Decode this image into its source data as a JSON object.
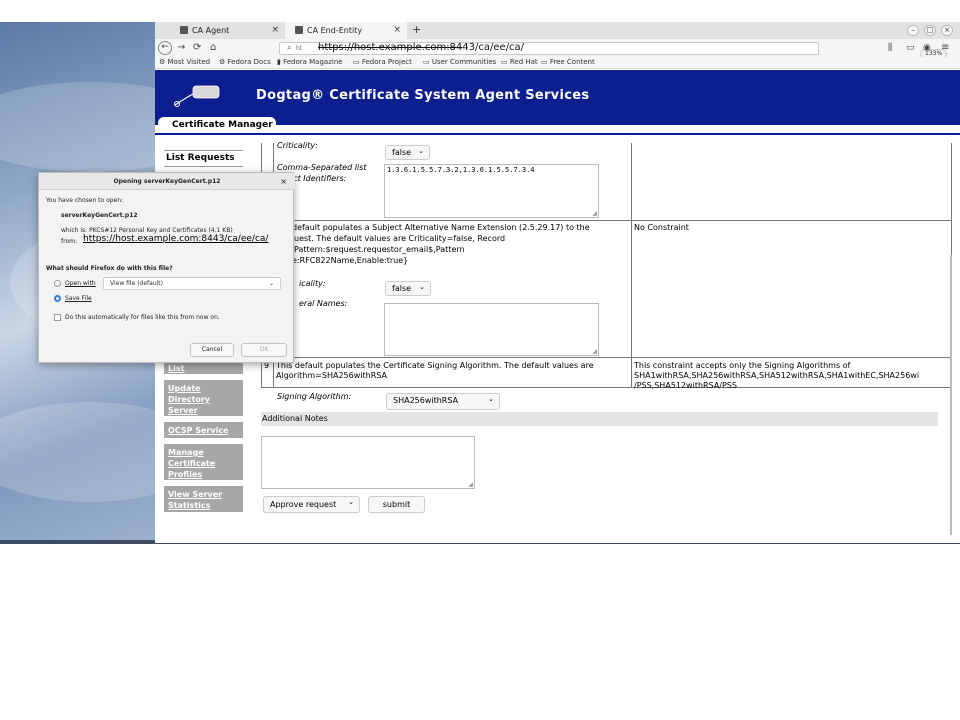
{
  "browser": {
    "tabs": [
      {
        "label": "CA Agent"
      },
      {
        "label": "CA End-Entity"
      }
    ],
    "new_tab": "+",
    "window_buttons": [
      "–",
      "□",
      "×"
    ],
    "url": {
      "struck": "https://host.example.com:84",
      "rest": "43/ca/ee/ca/",
      "prefix": "ht"
    },
    "zoom": "133%",
    "bookmarks": [
      "Most Visited",
      "Fedora Docs",
      "Fedora Magazine",
      "Fedora Project",
      "User Communities",
      "Red Hat",
      "Free Content"
    ]
  },
  "page": {
    "header_title": "Dogtag® Certificate System Agent Services",
    "logo_text": "Dogtag",
    "tab_label": "Certificate Manager",
    "sidebar": {
      "list_requests": "List Requests",
      "list_tail": "List",
      "update_directory": "Update Directory Server",
      "ocsp": "OCSP Service",
      "manage_profiles": "Manage Certificate Profiles",
      "view_stats": "View Server Statistics"
    },
    "row_top": {
      "criticality_label": "Criticality:",
      "criticality_value": "false",
      "oid_label_1": "Comma-Separated list",
      "oid_label_2": "bject Identifiers:",
      "oid_value": "1.3.6.1.5.5.7.3.2,1.3.6.1.5.5.7.3.4"
    },
    "row_san": {
      "desc_1": "default populates a Subject Alternative Name Extension (2.5.29.17) to the",
      "desc_2": "uest. The default values are Criticality=false, Record",
      "desc_3": "Pattern:$request.requestor_email$,Pattern",
      "desc_4": "e:RFC822Name,Enable:true}",
      "constraint": "No Constraint",
      "criticality_label": "icality:",
      "criticality_value": "false",
      "general_names_label": "eral Names:"
    },
    "row_9": {
      "number": "9",
      "desc_1": "This default populates the Certificate Signing Algorithm. The default values are",
      "desc_2": "Algorithm=SHA256withRSA",
      "constraint_1": "This constraint accepts only the Signing Algorithms of",
      "constraint_2": "SHA1withRSA,SHA256withRSA,SHA512withRSA,SHA1withEC,SHA256wi",
      "constraint_3": "/PSS,SHA512withRSA/PSS",
      "signing_label": "Signing Algorithm:",
      "signing_value": "SHA256withRSA"
    },
    "notes_label": "Additional Notes",
    "action_select": "Approve request",
    "submit_label": "submit"
  },
  "dialog": {
    "title": "Opening serverKeyGenCert.p12",
    "close": "×",
    "chosen": "You have chosen to open:",
    "filename": "serverKeyGenCert.p12",
    "which_is": "which is: PKCS#12 Personal Key and Certificates (4.1 KB)",
    "from_label": "from:",
    "from_url": "https://host.example.com:8443/ca/ee/ca/",
    "question": "What should Firefox do with this file?",
    "open_with": "Open with",
    "open_with_value": "View file (default)",
    "save_file": "Save File",
    "auto": "Do this automatically for files like this from now on.",
    "cancel": "Cancel",
    "ok": "OK"
  }
}
